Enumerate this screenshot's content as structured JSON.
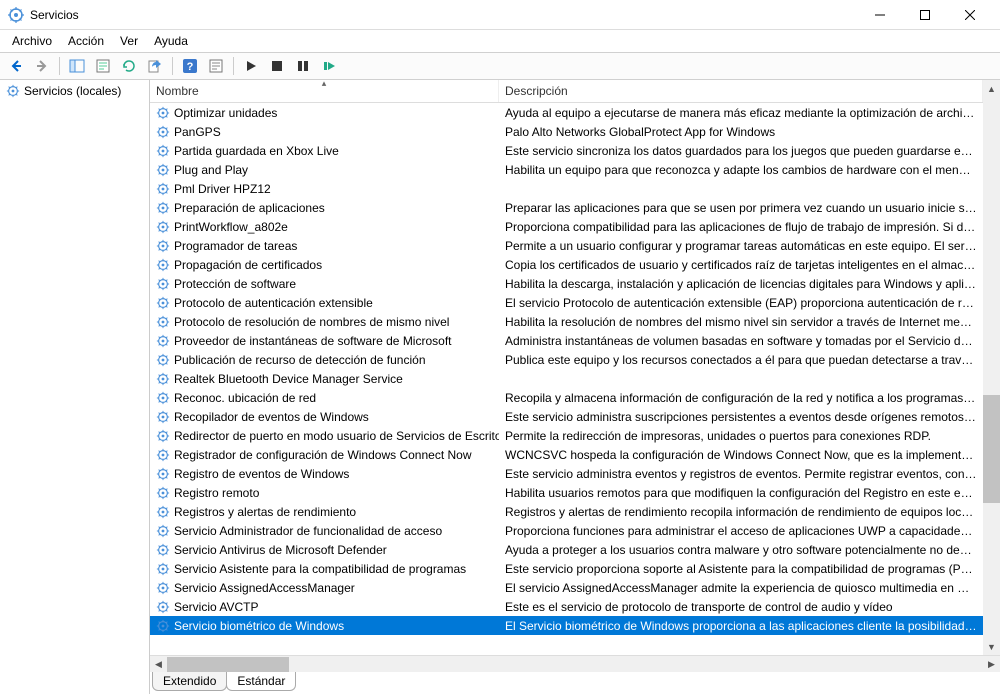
{
  "window": {
    "title": "Servicios"
  },
  "menu": {
    "items": [
      "Archivo",
      "Acción",
      "Ver",
      "Ayuda"
    ]
  },
  "sidebar": {
    "root": "Servicios (locales)"
  },
  "columns": {
    "name": "Nombre",
    "desc": "Descripción"
  },
  "tabs": {
    "extended": "Extendido",
    "standard": "Estándar"
  },
  "services": [
    {
      "name": "Optimizar unidades",
      "desc": "Ayuda al equipo a ejecutarse de manera más eficaz mediante la optimización de archivos en l"
    },
    {
      "name": "PanGPS",
      "desc": "Palo Alto Networks GlobalProtect App for Windows"
    },
    {
      "name": "Partida guardada en Xbox Live",
      "desc": "Este servicio sincroniza los datos guardados para los juegos que pueden guardarse en Xbox Li"
    },
    {
      "name": "Plug and Play",
      "desc": "Habilita un equipo para que reconozca y adapte los cambios de hardware con el menor esfue"
    },
    {
      "name": "Pml Driver HPZ12",
      "desc": ""
    },
    {
      "name": "Preparación de aplicaciones",
      "desc": "Preparar las aplicaciones para que se usen por primera vez cuando un usuario inicie sesión en"
    },
    {
      "name": "PrintWorkflow_a802e",
      "desc": "Proporciona compatibilidad para las aplicaciones de flujo de trabajo de impresión. Si desactiv"
    },
    {
      "name": "Programador de tareas",
      "desc": "Permite a un usuario configurar y programar tareas automáticas en este equipo. El servicio tar"
    },
    {
      "name": "Propagación de certificados",
      "desc": "Copia los certificados de usuario y certificados raíz de tarjetas inteligentes en el almacén de ce"
    },
    {
      "name": "Protección de software",
      "desc": "Habilita la descarga, instalación y aplicación de licencias digitales para Windows y aplicacione"
    },
    {
      "name": "Protocolo de autenticación extensible",
      "desc": "El servicio Protocolo de autenticación extensible (EAP) proporciona autenticación de red en e"
    },
    {
      "name": "Protocolo de resolución de nombres de mismo nivel",
      "desc": "Habilita la resolución de nombres del mismo nivel sin servidor a través de Internet mediante e"
    },
    {
      "name": "Proveedor de instantáneas de software de Microsoft",
      "desc": "Administra instantáneas de volumen basadas en software y tomadas por el Servicio de instant"
    },
    {
      "name": "Publicación de recurso de detección de función",
      "desc": "Publica este equipo y los recursos conectados a él para que puedan detectarse a través de la re"
    },
    {
      "name": "Realtek Bluetooth Device Manager Service",
      "desc": ""
    },
    {
      "name": "Reconoc. ubicación de red",
      "desc": "Recopila y almacena información de configuración de la red y notifica a los programas cuand"
    },
    {
      "name": "Recopilador de eventos de Windows",
      "desc": "Este servicio administra suscripciones persistentes a eventos desde orígenes remotos que adn"
    },
    {
      "name": "Redirector de puerto en modo usuario de Servicios de Escrito...",
      "desc": "Permite la redirección de impresoras, unidades o puertos para conexiones RDP."
    },
    {
      "name": "Registrador de configuración de Windows Connect Now",
      "desc": "WCNCSVC hospeda la configuración de Windows Connect Now, que es la implementación d"
    },
    {
      "name": "Registro de eventos de Windows",
      "desc": "Este servicio administra eventos y registros de eventos. Permite registrar eventos, consultar ev"
    },
    {
      "name": "Registro remoto",
      "desc": "Habilita usuarios remotos para que modifiquen la configuración del Registro en este equipo. S"
    },
    {
      "name": "Registros y alertas de rendimiento",
      "desc": "Registros y alertas de rendimiento recopila información de rendimiento de equipos locales o r"
    },
    {
      "name": "Servicio Administrador de funcionalidad de acceso",
      "desc": "Proporciona funciones para administrar el acceso de aplicaciones UWP a capacidades de la ap"
    },
    {
      "name": "Servicio Antivirus de Microsoft Defender",
      "desc": "Ayuda a proteger a los usuarios contra malware y otro software potencialmente no deseado"
    },
    {
      "name": "Servicio Asistente para la compatibilidad de programas",
      "desc": "Este servicio proporciona soporte al Asistente para la compatibilidad de programas (PCA). PC"
    },
    {
      "name": "Servicio AssignedAccessManager",
      "desc": "El servicio AssignedAccessManager admite la experiencia de quiosco multimedia en Windows"
    },
    {
      "name": "Servicio AVCTP",
      "desc": "Este es el servicio de protocolo de transporte de control de audio y vídeo"
    },
    {
      "name": "Servicio biométrico de Windows",
      "desc": "El Servicio biométrico de Windows proporciona a las aplicaciones cliente la posibilidad de cap",
      "selected": true
    }
  ]
}
